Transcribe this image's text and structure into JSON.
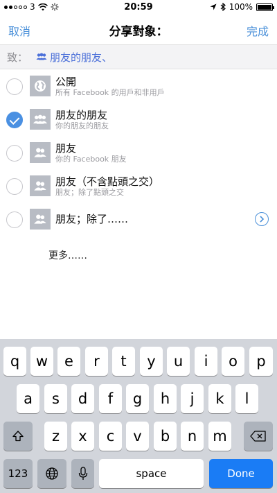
{
  "status_bar": {
    "carrier": "3",
    "time": "20:59",
    "battery": "100%",
    "battery_level": 1.0
  },
  "nav": {
    "cancel_label": "取消",
    "title": "分享對象：",
    "done_label": "完成"
  },
  "to_row": {
    "label": "致：",
    "value": "朋友的朋友、"
  },
  "audience_options": [
    {
      "title": "公開",
      "subtitle": "所有 Facebook 的用戶和非用戶",
      "icon": "globe-icon",
      "selected": false
    },
    {
      "title": "朋友的朋友",
      "subtitle": "你的朋友的朋友",
      "icon": "friends-group-icon",
      "selected": true
    },
    {
      "title": "朋友",
      "subtitle": "你的 Facebook 朋友",
      "icon": "friends-icon",
      "selected": false
    },
    {
      "title": "朋友（不含點頭之交）",
      "subtitle": "朋友；除了點頭之交",
      "icon": "friends-icon",
      "selected": false
    },
    {
      "title": "朋友；除了……",
      "subtitle": "",
      "icon": "friends-except-icon",
      "selected": false
    }
  ],
  "more_label": "更多……",
  "keyboard": {
    "row1": [
      "q",
      "w",
      "e",
      "r",
      "t",
      "y",
      "u",
      "i",
      "o",
      "p"
    ],
    "row2": [
      "a",
      "s",
      "d",
      "f",
      "g",
      "h",
      "j",
      "k",
      "l"
    ],
    "row3": [
      "z",
      "x",
      "c",
      "v",
      "b",
      "n",
      "m"
    ],
    "numbers_label": "123",
    "space_label": "space",
    "done_label": "Done"
  },
  "colors": {
    "accent": "#4a90d9",
    "done_key": "#1a7cf5",
    "keyboard_bg": "#d2d5db"
  }
}
